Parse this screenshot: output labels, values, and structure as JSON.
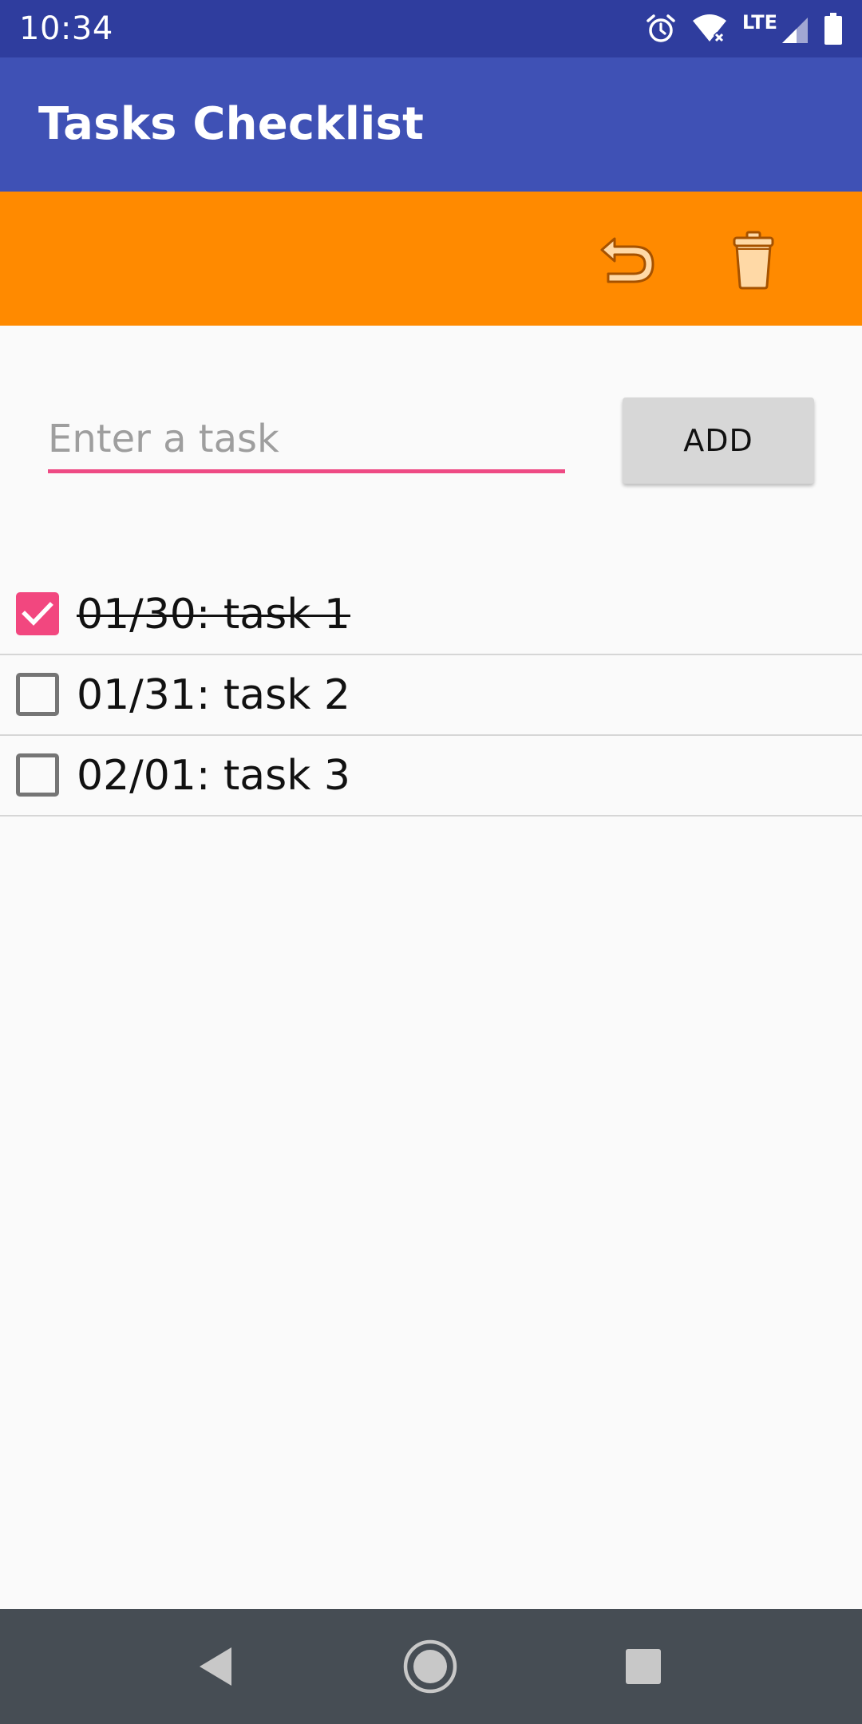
{
  "status_bar": {
    "time": "10:34",
    "network_label": "LTE",
    "icons": [
      "alarm-icon",
      "wifi-icon",
      "signal-icon",
      "battery-icon"
    ]
  },
  "app_bar": {
    "title": "Tasks Checklist",
    "color": "#3f51b5"
  },
  "toolbar": {
    "color": "#ff8a00",
    "actions": [
      "undo-icon",
      "trash-icon"
    ]
  },
  "input_row": {
    "placeholder": "Enter a task",
    "value": "",
    "add_label": "ADD",
    "accent_color": "#ee4a84"
  },
  "tasks": [
    {
      "label": "01/30: task 1",
      "checked": true
    },
    {
      "label": "01/31: task 2",
      "checked": false
    },
    {
      "label": "02/01: task 3",
      "checked": false
    }
  ],
  "nav_bar": {
    "buttons": [
      "back-icon",
      "home-icon",
      "recents-icon"
    ]
  }
}
